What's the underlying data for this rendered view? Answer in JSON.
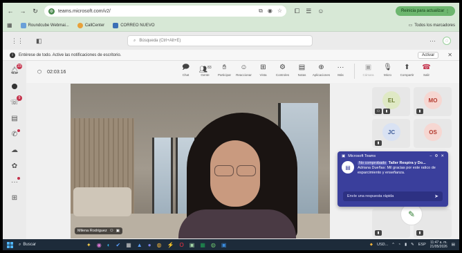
{
  "browser": {
    "url": "teams.microsoft.com/v2/",
    "update_button": "Reinicia para actualizar",
    "bookmarks": [
      {
        "label": "Roundcube Webmai...",
        "color": "#6aa0d8"
      },
      {
        "label": "CallCenter",
        "color": "#e8a13a"
      },
      {
        "label": "CORREO NUEVO",
        "color": "#3b6fb6"
      }
    ],
    "bookmarks_right": "Todos los marcadores"
  },
  "teams": {
    "search_placeholder": "Búsqueda (Ctrl+Alt+E)"
  },
  "banner": {
    "text": "Entérese de todo. Active las notificaciones de escritorio.",
    "activate_label": "Activar"
  },
  "rail": {
    "items": [
      {
        "icon": "bell-icon",
        "badge": "23"
      },
      {
        "icon": "chat-dot-icon",
        "badge": ""
      },
      {
        "icon": "chat-icon",
        "badge": "9"
      },
      {
        "icon": "calendar-icon",
        "badge": ""
      },
      {
        "icon": "calls-icon",
        "badge": ""
      },
      {
        "icon": "cloud-icon",
        "badge": ""
      },
      {
        "icon": "copilot-icon",
        "badge": ""
      },
      {
        "icon": "more-icon",
        "badge": ""
      },
      {
        "icon": "add-apps-icon",
        "badge": ""
      }
    ]
  },
  "meeting": {
    "timer": "02:03:16",
    "tools": [
      {
        "icon": "chat-icon",
        "label": "Chat"
      },
      {
        "icon": "people-icon",
        "label": "Gente",
        "count": "83"
      },
      {
        "icon": "raise-hand-icon",
        "label": "Participar"
      },
      {
        "icon": "react-icon",
        "label": "Reaccionar"
      },
      {
        "icon": "view-icon",
        "label": "Vista"
      },
      {
        "icon": "controls-icon",
        "label": "Controles"
      },
      {
        "icon": "notes-icon",
        "label": "Notas"
      },
      {
        "icon": "apps-icon",
        "label": "Aplicaciones"
      },
      {
        "icon": "more-icon",
        "label": "Más"
      }
    ],
    "right_tools": [
      {
        "icon": "camera-icon",
        "label": "Cámara"
      },
      {
        "icon": "mic-icon",
        "label": "Micro"
      },
      {
        "icon": "share-icon",
        "label": "Compartir"
      },
      {
        "icon": "leave-icon",
        "label": "Salir"
      }
    ],
    "speaker_name": "Milena Rodriguez"
  },
  "participants": [
    {
      "initials": "EL",
      "bg": "#dfe9c5",
      "fg": "#6a7b2f"
    },
    {
      "initials": "MO",
      "bg": "#f6d7d2",
      "fg": "#b33a2e"
    },
    {
      "initials": "JC",
      "bg": "#d9e2f3",
      "fg": "#3f5d9a"
    },
    {
      "initials": "OS",
      "bg": "#f6d7d2",
      "fg": "#b33a2e"
    }
  ],
  "toast": {
    "app": "Microsoft Teams",
    "tag": "No comprobado",
    "title": "Taller Respira y Do...",
    "message": "Adriana Dueñas: Mil gracias por este ratico de esparcimiento y enseñanza.",
    "reply_placeholder": "Envíe una respuesta rápida"
  },
  "taskbar": {
    "search_label": "Buscar",
    "weather": "USD...",
    "lang": "ESP",
    "time": "11:47 a. m.",
    "date": "21/05/2026"
  }
}
